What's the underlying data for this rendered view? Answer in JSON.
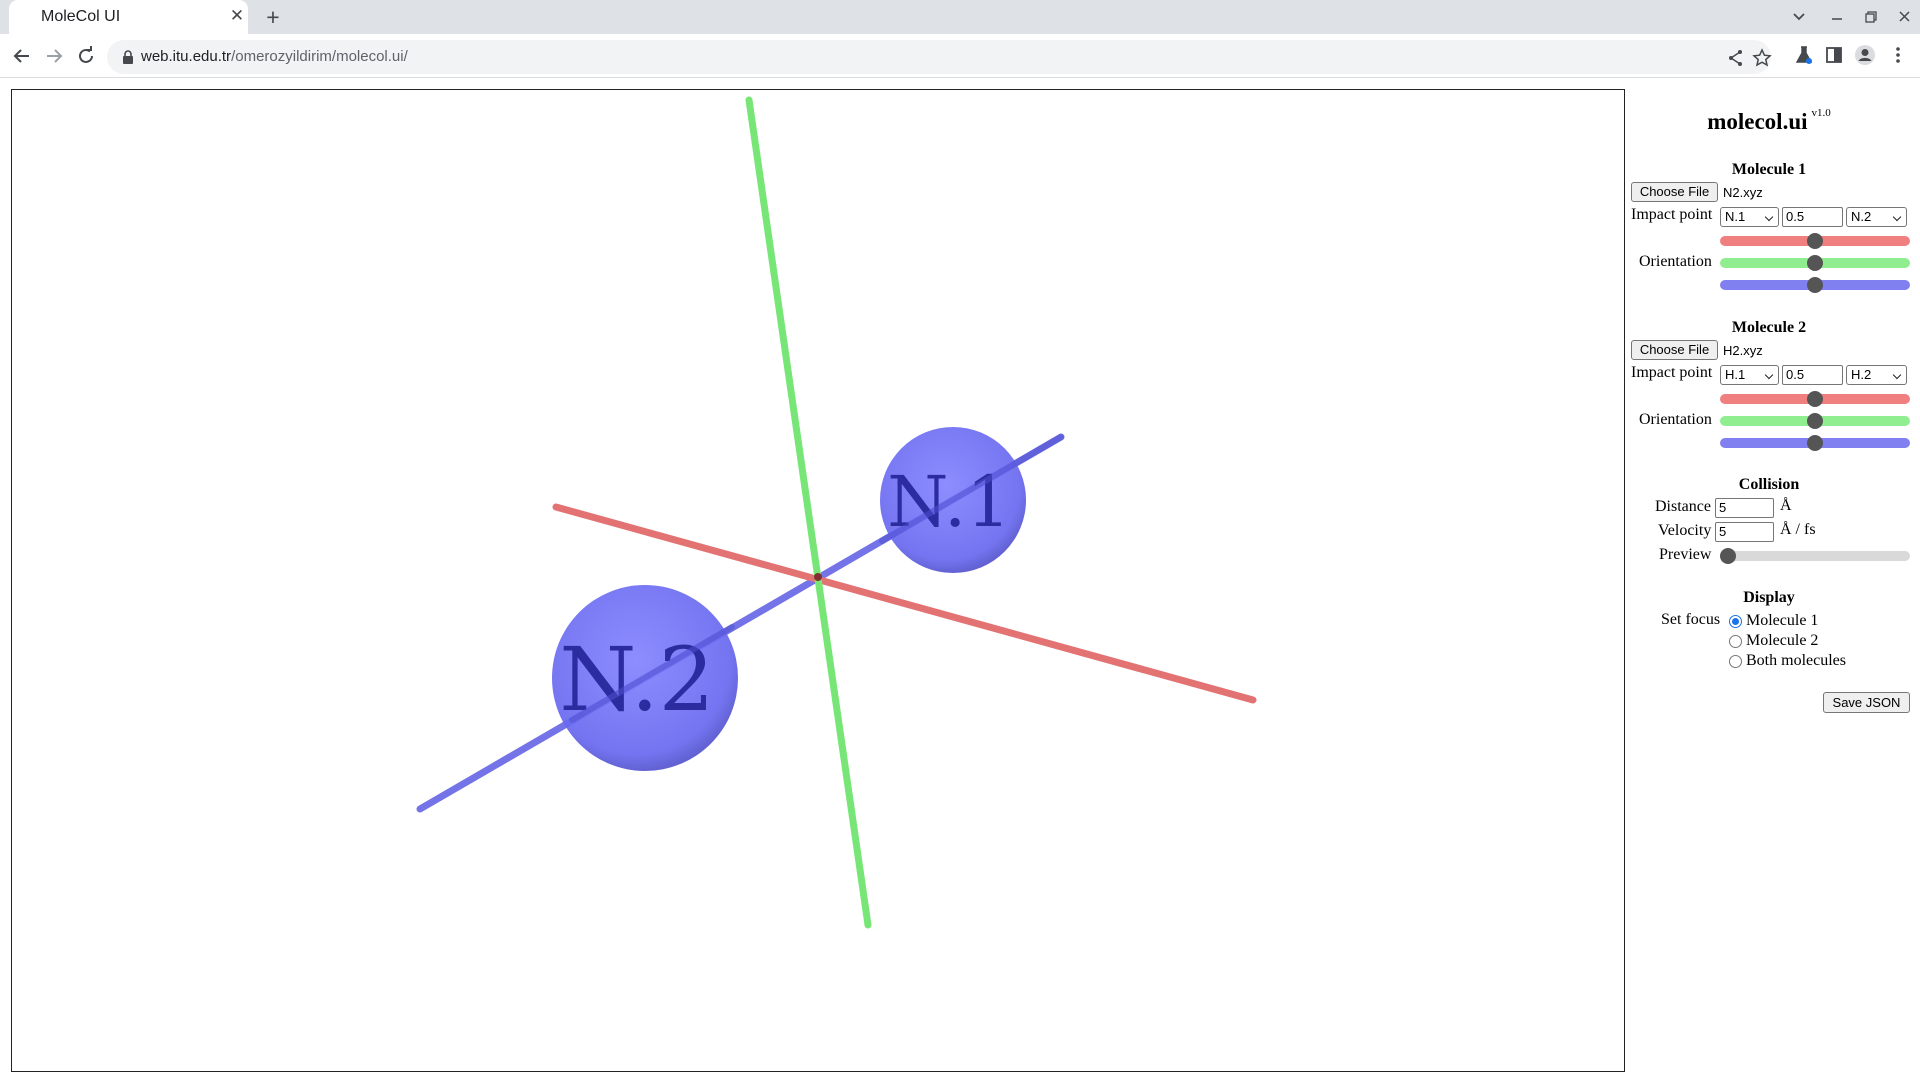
{
  "browser": {
    "tab_title": "MoleCol UI",
    "url_host": "web.itu.edu.tr",
    "url_path": "/omerozyildirim/molecol.ui/"
  },
  "app": {
    "title": "molecol.ui",
    "version": "v1.0"
  },
  "scene": {
    "atoms": [
      {
        "label": "N.1"
      },
      {
        "label": "N.2"
      }
    ],
    "colors": {
      "x_axis": "#e06666",
      "y_axis": "#66e066",
      "z_axis": "#6666e6",
      "atom": "#6a6af0"
    }
  },
  "molecule1": {
    "title": "Molecule 1",
    "choose_file_label": "Choose File",
    "file_name": "N2.xyz",
    "impact_label": "Impact point",
    "impact_from": "N.1",
    "impact_value": "0.5",
    "impact_to": "N.2",
    "orientation_label": "Orientation",
    "orientation": {
      "red": 0.5,
      "green": 0.5,
      "blue": 0.5
    }
  },
  "molecule2": {
    "title": "Molecule 2",
    "choose_file_label": "Choose File",
    "file_name": "H2.xyz",
    "impact_label": "Impact point",
    "impact_from": "H.1",
    "impact_value": "0.5",
    "impact_to": "H.2",
    "orientation_label": "Orientation",
    "orientation": {
      "red": 0.5,
      "green": 0.5,
      "blue": 0.5
    }
  },
  "collision": {
    "title": "Collision",
    "distance_label": "Distance",
    "distance_value": "5",
    "distance_unit": "Å",
    "velocity_label": "Velocity",
    "velocity_value": "5",
    "velocity_unit": "Å / fs",
    "preview_label": "Preview",
    "preview": 0
  },
  "display": {
    "title": "Display",
    "set_focus_label": "Set focus",
    "options": [
      "Molecule 1",
      "Molecule 2",
      "Both molecules"
    ],
    "selected": "Molecule 1"
  },
  "save_json_label": "Save JSON"
}
